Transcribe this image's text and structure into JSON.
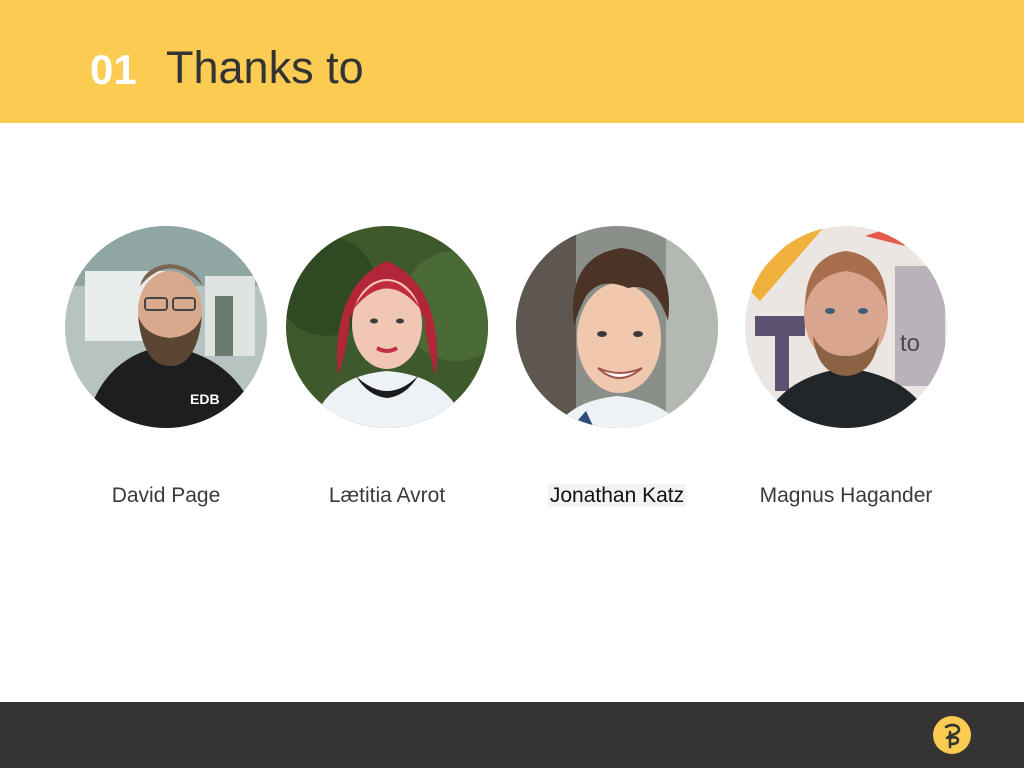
{
  "slide": {
    "number": "01",
    "title": "Thanks to"
  },
  "people": [
    {
      "name": "David Page"
    },
    {
      "name": "Lætitia Avrot"
    },
    {
      "name": "Jonathan Katz"
    },
    {
      "name": "Magnus Hagander"
    }
  ],
  "logo": {
    "icon": "company-logo-icon"
  },
  "colors": {
    "header": "#fccc52",
    "footer": "#363433",
    "title_text": "#333333",
    "number_text": "#ffffff"
  }
}
